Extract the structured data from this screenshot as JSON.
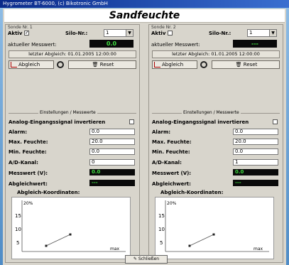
{
  "window": {
    "title": "Hygrometer BT-6000, (c) Bikotronic GmbH"
  },
  "header": {
    "title": "Sandfeuchte"
  },
  "panels": [
    {
      "sonde": "Sonde Nr. 1",
      "aktiv_label": "Aktiv",
      "aktiv_checked": "✓",
      "silo_label": "Silo-Nr.:",
      "silo_value": "1",
      "messwert_label": "aktueller Messwert:",
      "messwert_value": "0.0",
      "letzter_abgleich": "letzter Abgleich: 01.01.2005 12:00:00",
      "abgleich_btn": "Abgleich",
      "reset_btn": "Reset",
      "section": "Einstellungen / Messwerte",
      "invert_label": "Analog-Eingangssignal invertieren",
      "alarm_label": "Alarm:",
      "alarm_value": "0.0",
      "max_label": "Max. Feuchte:",
      "max_value": "20.0",
      "min_label": "Min. Feuchte:",
      "min_value": "0.0",
      "ad_label": "A/D-Kanal:",
      "ad_value": "0",
      "mess_label": "Messwert (V):",
      "mess_value": "0.0",
      "abgl_label": "Abgleichwert:",
      "abgl_value": "---",
      "koord_label": "Abgleich-Koordinaten:",
      "chart": {
        "top": "20%",
        "y_ticks": [
          "15",
          "10",
          "5"
        ],
        "x_max": "max"
      }
    },
    {
      "sonde": "Sonde Nr. 2",
      "aktiv_label": "Aktiv",
      "aktiv_checked": "",
      "silo_label": "Silo-Nr.:",
      "silo_value": "1",
      "messwert_label": "aktueller Messwert:",
      "messwert_value": "---",
      "letzter_abgleich": "letzter Abgleich: 01.01.2005 12:00:00",
      "abgleich_btn": "Abgleich",
      "reset_btn": "Reset",
      "section": "Einstellungen / Messwerte",
      "invert_label": "Analog-Eingangssignal invertieren",
      "alarm_label": "Alarm:",
      "alarm_value": "0.0",
      "max_label": "Max. Feuchte:",
      "max_value": "20.0",
      "min_label": "Min. Feuchte:",
      "min_value": "0.0",
      "ad_label": "A/D-Kanal:",
      "ad_value": "1",
      "mess_label": "Messwert (V):",
      "mess_value": "0.0",
      "abgl_label": "Abgleichwert:",
      "abgl_value": "---",
      "koord_label": "Abgleich-Koordinaten:",
      "chart": {
        "top": "20%",
        "y_ticks": [
          "15",
          "10",
          "5"
        ],
        "x_max": "max"
      }
    }
  ],
  "footer": {
    "close_btn": "Schließen"
  },
  "colors": {
    "title_start": "#0a2a8a",
    "title_end": "#3a6fd0",
    "lcd_text": "#3fdc3f",
    "lcd_bg": "#0a0a0a"
  }
}
